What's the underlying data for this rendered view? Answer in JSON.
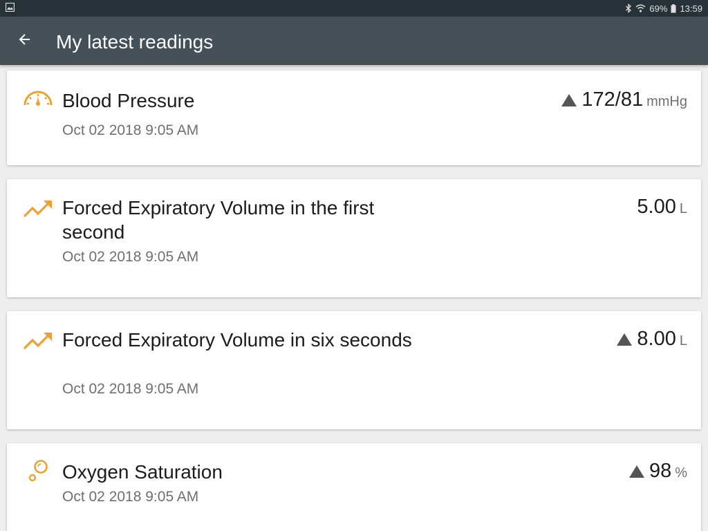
{
  "status_bar": {
    "battery": "69%",
    "time": "13:59",
    "icons": [
      "image-icon",
      "bluetooth-icon",
      "wifi-icon",
      "battery-icon"
    ]
  },
  "app_bar": {
    "back_icon": "arrow-left-icon",
    "title": "My latest readings"
  },
  "colors": {
    "status_bar": "#263238",
    "app_bar": "#455058",
    "accent": "#f0a030",
    "background": "#eeeeee"
  },
  "readings": [
    {
      "icon": "gauge-icon",
      "title": "Blood Pressure",
      "date": "Oct 02 2018 9:05 AM",
      "trend": "up-triangle-icon",
      "value": "172/81",
      "unit": "mmHg"
    },
    {
      "icon": "trending-up-icon",
      "title": "Forced Expiratory Volume in the first second",
      "date": "Oct 02 2018 9:05 AM",
      "trend": "",
      "value": "5.00",
      "unit": "L"
    },
    {
      "icon": "trending-up-icon",
      "title": "Forced Expiratory Volume in six seconds",
      "date": "Oct 02 2018 9:05 AM",
      "trend": "up-triangle-icon",
      "value": "8.00",
      "unit": "L"
    },
    {
      "icon": "bubbles-icon",
      "title": "Oxygen Saturation",
      "date": "Oct 02 2018 9:05 AM",
      "trend": "up-triangle-icon",
      "value": "98",
      "unit": "%"
    }
  ]
}
